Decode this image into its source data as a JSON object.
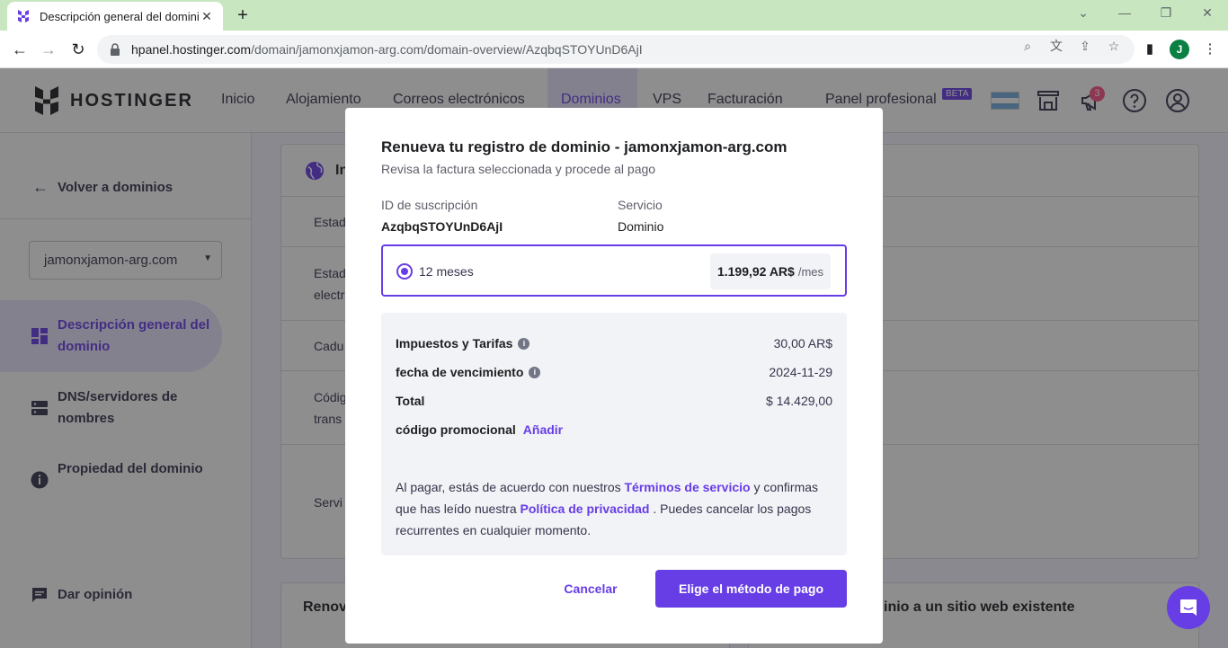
{
  "browser": {
    "tab_title": "Descripción general del dominio",
    "tab_close": "✕",
    "new_tab": "+",
    "url_host": "hpanel.hostinger.com",
    "url_path": "/domain/jamonxjamon-arg.com/domain-overview/AzqbqSTOYUnD6AjI",
    "profile_initial": "J"
  },
  "header": {
    "brand": "HOSTINGER",
    "nav": [
      "Inicio",
      "Alojamiento",
      "Correos electrónicos",
      "Dominios",
      "VPS",
      "Facturación",
      "Panel profesional"
    ],
    "active_nav": "Dominios",
    "beta_label": "BETA",
    "notification_count": "3"
  },
  "sidebar": {
    "back_label": "Volver a dominios",
    "selected_domain": "jamonxjamon-arg.com",
    "items": [
      {
        "label": "Descripción general del dominio"
      },
      {
        "label": "DNS/servidores de nombres"
      },
      {
        "label": "Propiedad del dominio"
      }
    ],
    "feedback_label": "Dar opinión"
  },
  "background": {
    "card_title": "In",
    "row_labels": [
      "Estad",
      "Estad",
      "electr",
      "Cadu",
      "Códig",
      "trans",
      "Servi"
    ],
    "bottom_left_title": "Renov",
    "bottom_right_title": "inio a un sitio web existente"
  },
  "modal": {
    "title": "Renueva tu registro de dominio - jamonxjamon-arg.com",
    "subtitle": "Revisa la factura seleccionada y procede al pago",
    "subscription_label": "ID de suscripción",
    "subscription_id": "AzqbqSTOYUnD6AjI",
    "service_label": "Servicio",
    "service_value": "Dominio",
    "period_label": "12 meses",
    "price": "1.199,92 AR$",
    "price_unit": "/mes",
    "taxes_label": "Impuestos y Tarifas",
    "taxes_value": "30,00 AR$",
    "expiry_label": "fecha de vencimiento",
    "expiry_value": "2024-11-29",
    "total_label": "Total",
    "total_value": "$ 14.429,00",
    "promo_label": "código promocional",
    "promo_add": "Añadir",
    "terms_1": "Al pagar, estás de acuerdo con nuestros",
    "terms_link_1": "Términos de servicio",
    "terms_2": "y confirmas que has leído nuestra",
    "terms_link_2": "Política de privacidad",
    "terms_3": ". Puedes cancelar los pagos recurrentes en cualquier momento.",
    "cancel_label": "Cancelar",
    "pay_label": "Elige el método de pago"
  },
  "colors": {
    "accent": "#673de6",
    "tabbar": "#c8e6c0"
  }
}
